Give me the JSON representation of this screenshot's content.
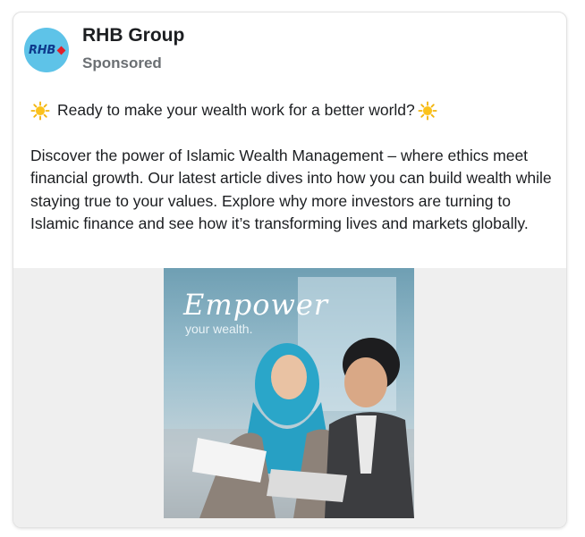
{
  "post": {
    "page_name": "RHB Group",
    "sponsored_label": "Sponsored",
    "avatar_logo_text": "RHB",
    "headline_text": "Ready to make your wealth work for a better world?",
    "body_text": "Discover the power of Islamic Wealth Management – where ethics meet financial growth. Our latest article dives into how you can build wealth while staying true to your values. Explore why more investors are turning to Islamic finance and see how it’s transforming lives and markets globally.",
    "headline_icons": [
      "sun-icon",
      "sun-icon"
    ]
  },
  "ad_image": {
    "title": "Empower",
    "subtitle": "your wealth."
  },
  "colors": {
    "avatar_bg": "#5ec3e8",
    "logo_blue": "#0e3a8c",
    "logo_red": "#e0202a",
    "text": "#1c1e21",
    "secondary_text": "#6b6f73",
    "media_bg": "#efefef"
  }
}
